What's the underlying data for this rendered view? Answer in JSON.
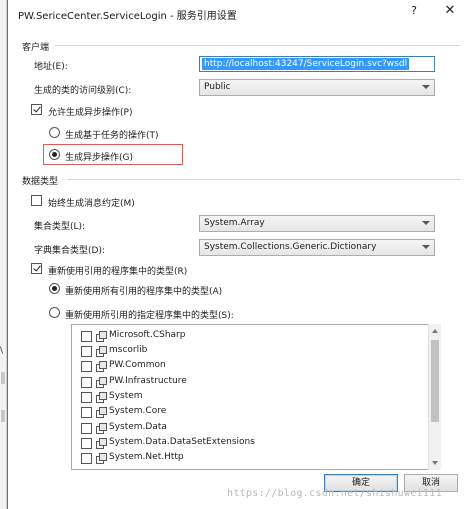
{
  "window": {
    "title": "PW.SericeCenter.ServiceLogin - 服务引用设置",
    "help_glyph": "?",
    "close_glyph": "✕"
  },
  "client_group": {
    "title": "客户端",
    "address_label": "地址(E):",
    "address_value": "http://localhost:43247/ServiceLogin.svc?wsdl",
    "access_level_label": "生成的类的访问级别(C):",
    "access_level_value": "Public",
    "allow_async_label": "允许生成异步操作(P)",
    "allow_async_checked": true,
    "task_based_label": "生成基于任务的操作(T)",
    "async_ops_label": "生成异步操作(G)",
    "selected_mode": "async"
  },
  "data_type_group": {
    "title": "数据类型",
    "always_generate_contracts_label": "始终生成消息约定(M)",
    "always_generate_contracts_checked": false,
    "collection_type_label": "集合类型(L):",
    "collection_type_value": "System.Array",
    "dictionary_type_label": "字典集合类型(D):",
    "dictionary_type_value": "System.Collections.Generic.Dictionary",
    "reuse_types_label": "重新使用引用的程序集中的类型(R)",
    "reuse_types_checked": true,
    "reuse_all_label": "重新使用所有引用的程序集中的类型(A)",
    "reuse_specified_label": "重新使用所引用的指定程序集中的类型(S):",
    "reuse_mode": "all",
    "assemblies": [
      {
        "name": "Microsoft.CSharp",
        "checked": false
      },
      {
        "name": "mscorlib",
        "checked": false
      },
      {
        "name": "PW.Common",
        "checked": false
      },
      {
        "name": "PW.Infrastructure",
        "checked": false
      },
      {
        "name": "System",
        "checked": false
      },
      {
        "name": "System.Core",
        "checked": false
      },
      {
        "name": "System.Data",
        "checked": false
      },
      {
        "name": "System.Data.DataSetExtensions",
        "checked": false
      },
      {
        "name": "System.Net.Http",
        "checked": false
      }
    ]
  },
  "buttons": {
    "ok_label": "确定",
    "cancel_label": "取消"
  },
  "watermark": "https://blog.csdn.net/shishuwei111",
  "background": {
    "glyph": "\\"
  },
  "colors": {
    "accent": "#3c7fb1",
    "selection": "#3399ff",
    "highlight_border": "#e05a5a"
  }
}
